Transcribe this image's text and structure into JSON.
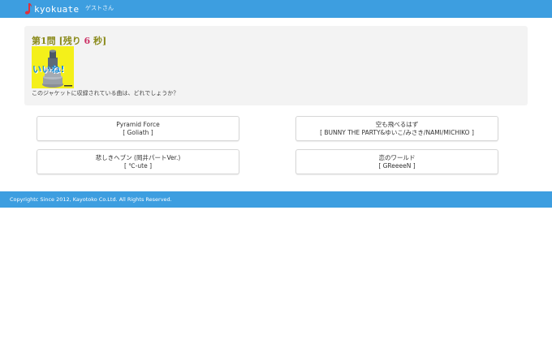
{
  "header": {
    "brand": "kyokuate",
    "user": "ゲストさん"
  },
  "quiz": {
    "title_prefix": "第1問 [残り ",
    "seconds_left": "6",
    "title_suffix": " 秒]",
    "jacket_text": "いいね!",
    "question": "このジャケットに収録されている曲は、どれでしょうか？"
  },
  "answers": [
    {
      "title": "Pyramid Force",
      "artist": "[ Goliath ]"
    },
    {
      "title": "空も飛べるはず",
      "artist": "[ BUNNY THE PARTY&ゆいこ/みさき/NAMI/MICHIKO ]"
    },
    {
      "title": "悲しきヘブン (岡井パートVer.)",
      "artist": "[ ℃-ute ]"
    },
    {
      "title": "恋のワールド",
      "artist": "[ GReeeeN ]"
    }
  ],
  "footer": {
    "copyright": "Copyrightc Since 2012, Kayotoko Co.Ltd. All Rights Reserved."
  },
  "colors": {
    "header_bg": "#3d9ee0",
    "footer_bg": "#3d9ee0",
    "title_color": "#8a8a1a",
    "countdown_color": "#cc3366",
    "jacket_bg": "#f4f01a",
    "brand_icon": "#e0303a"
  }
}
